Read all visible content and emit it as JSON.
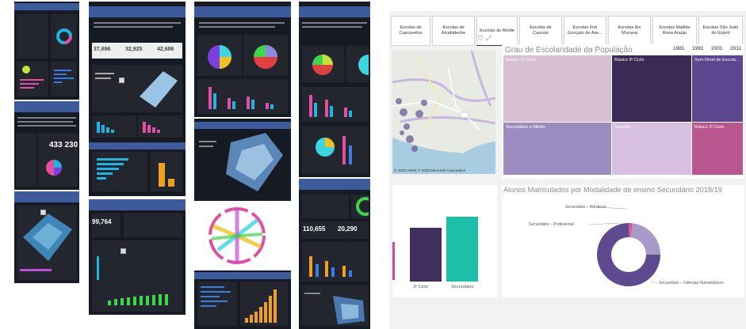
{
  "thumbnails": {
    "big_numbers": [
      "433 230",
      "37,696",
      "32,925",
      "42,686",
      "99,764",
      "110,655",
      "20,290"
    ]
  },
  "report": {
    "slicers": [
      {
        "label": "Escolas de Cascavelos"
      },
      {
        "label": "Escolas de Alcabideche"
      },
      {
        "label": "Escolas de Alvide"
      },
      {
        "label": "Escolas de Cascais"
      },
      {
        "label": "Escolas Frei Gonçalo de Aze..."
      },
      {
        "label": "Escolas Ibn Mucana"
      },
      {
        "label": "Escolas Matilde Rosa Araújo"
      },
      {
        "label": "Escolas São João do Estoril"
      }
    ],
    "map": {
      "attribution": "© 2020 HERE © 2020 Microsoft Corporation"
    },
    "treemap": {
      "title": "Grau de Escolaridade da População",
      "years": [
        "1981",
        "1991",
        "2001",
        "2011"
      ],
      "cells": [
        {
          "label": "Básico 1º Ciclo",
          "color": "#d8c0d4"
        },
        {
          "label": "Básico 3º Ciclo",
          "color": "#3c2a55"
        },
        {
          "label": "Sem Nível de Escola...",
          "color": "#5d4590"
        },
        {
          "label": "Secundário e Médio",
          "color": "#9a8cbf"
        },
        {
          "label": "Superior",
          "color": "#d6bfe0"
        },
        {
          "label": "Básico 2º Ciclo",
          "color": "#b9558f"
        }
      ]
    },
    "bar_chart": {
      "categories": [
        "3º Ciclo",
        "Secundário"
      ],
      "colors": [
        "#3e2f5e",
        "#1dbfa8"
      ]
    },
    "donut": {
      "title": "Alunos Matriculados por Modalidade de ensino Secundário 2018/19",
      "labels": [
        "Secundário – Artísticos",
        "Secundário – Profissional",
        "Secundário – Ciências Humanísticos"
      ],
      "colors": [
        "#d45a9c",
        "#a79ac9",
        "#5e4a8f"
      ]
    }
  },
  "chart_data": [
    {
      "type": "bar",
      "categories": [
        "3º Ciclo",
        "Secundário"
      ],
      "values": [
        68,
        82
      ]
    },
    {
      "type": "pie",
      "title": "Alunos Matriculados por Modalidade de ensino Secundário 2018/19",
      "categories": [
        "Secundário – Artísticos",
        "Secundário – Profissional",
        "Secundário – Ciências Humanísticos"
      ],
      "values": [
        2,
        23,
        75
      ]
    }
  ]
}
